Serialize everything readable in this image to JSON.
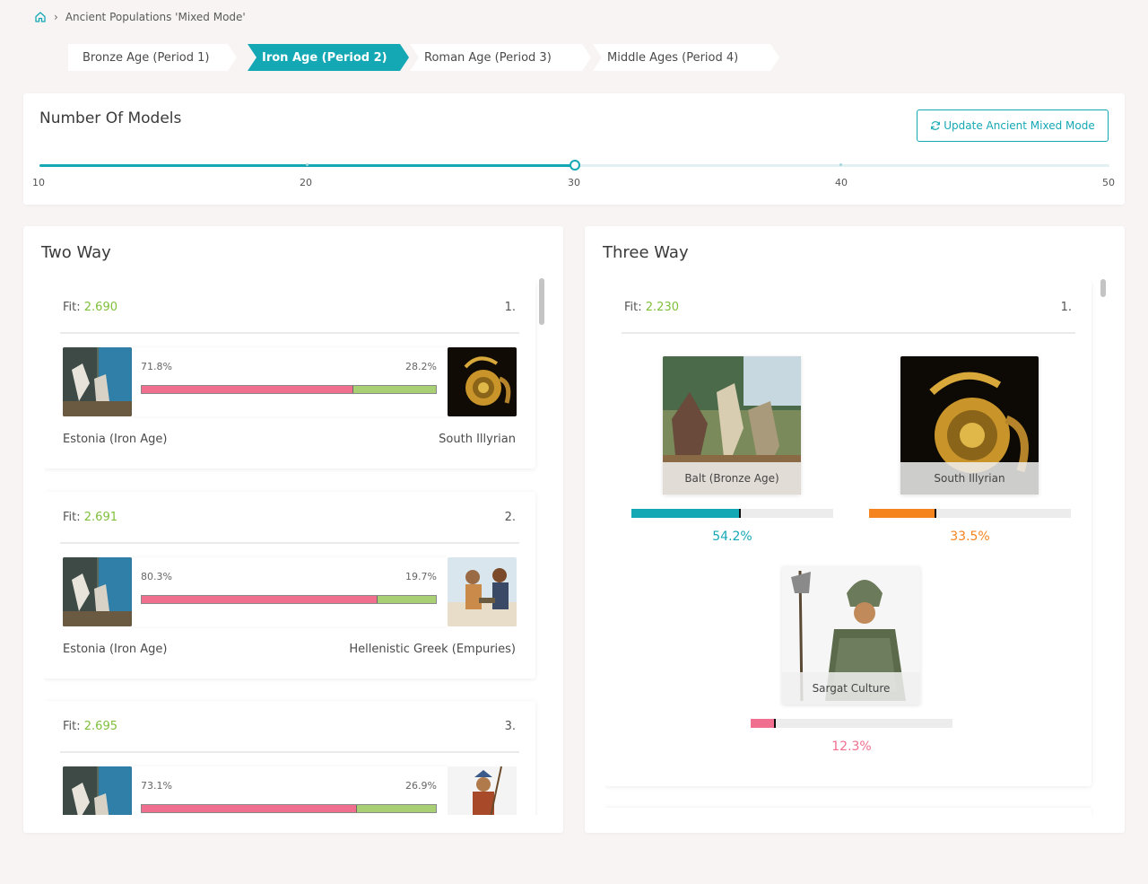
{
  "breadcrumb": {
    "home_icon": "home-icon",
    "current": "Ancient Populations 'Mixed Mode'"
  },
  "tabs": [
    {
      "label": "Bronze Age (Period 1)",
      "active": false
    },
    {
      "label": "Iron Age (Period 2)",
      "active": true
    },
    {
      "label": "Roman Age (Period 3)",
      "active": false
    },
    {
      "label": "Middle Ages (Period 4)",
      "active": false
    }
  ],
  "models": {
    "title": "Number Of Models",
    "update_label": "Update Ancient Mixed Mode",
    "slider": {
      "min": 10,
      "max": 50,
      "value": 30,
      "ticks": [
        "10",
        "20",
        "30",
        "40",
        "50"
      ]
    }
  },
  "two_way": {
    "title": "Two Way",
    "fit_prefix": "Fit:",
    "results": [
      {
        "fit": "2.690",
        "rank": "1.",
        "left_pct": "71.8%",
        "right_pct": "28.2%",
        "left_value": 71.8,
        "left_name": "Estonia (Iron Age)",
        "right_name": "South Illyrian"
      },
      {
        "fit": "2.691",
        "rank": "2.",
        "left_pct": "80.3%",
        "right_pct": "19.7%",
        "left_value": 80.3,
        "left_name": "Estonia (Iron Age)",
        "right_name": "Hellenistic Greek (Empuries)"
      },
      {
        "fit": "2.695",
        "rank": "3.",
        "left_pct": "73.1%",
        "right_pct": "26.9%",
        "left_value": 73.1,
        "left_name": "",
        "right_name": ""
      }
    ]
  },
  "three_way": {
    "title": "Three Way",
    "fit_prefix": "Fit:",
    "fit": "2.230",
    "rank": "1.",
    "components": [
      {
        "name": "Balt (Bronze Age)",
        "pct": "54.2%",
        "value": 54.2,
        "color": "#14a8b4"
      },
      {
        "name": "South Illyrian",
        "pct": "33.5%",
        "value": 33.5,
        "color": "#f5841f"
      },
      {
        "name": "Sargat Culture",
        "pct": "12.3%",
        "value": 12.3,
        "color": "#f06f8f"
      }
    ]
  },
  "colors": {
    "accent": "#14a8b4",
    "fit_value": "#7fbf3a",
    "bar_primary": "#f06f8f",
    "bar_secondary": "#a8cf74"
  }
}
